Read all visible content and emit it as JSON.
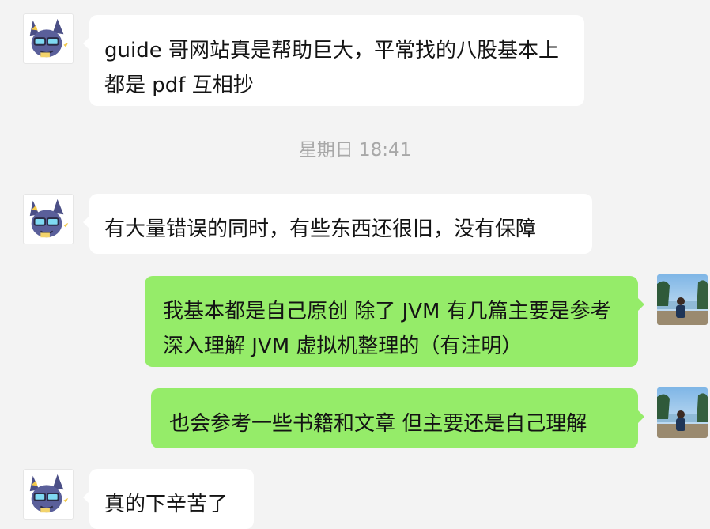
{
  "conversation": {
    "messages": [
      {
        "direction": "in",
        "text": "guide 哥网站真是帮助巨大，平常找的八股基本上都是 pdf 互相抄"
      },
      {
        "direction": "in",
        "text": "有大量错误的同时，有些东西还很旧，没有保障"
      },
      {
        "direction": "out",
        "text": "我基本都是自己原创 除了 JVM 有几篇主要是参考深入理解 JVM 虚拟机整理的（有注明）"
      },
      {
        "direction": "out",
        "text": "也会参考一些书籍和文章 但主要还是自己理解"
      },
      {
        "direction": "in",
        "text": "真的下辛苦了"
      }
    ],
    "timestamp": "星期日 18:41"
  },
  "colors": {
    "background": "#f3f3f3",
    "incoming_bubble": "#ffffff",
    "outgoing_bubble": "#95ec69",
    "timestamp_text": "#a8a8a8"
  },
  "icons": {
    "contact_avatar": "cartoon-cat-avatar-icon",
    "self_avatar": "landscape-photo-avatar-icon"
  }
}
